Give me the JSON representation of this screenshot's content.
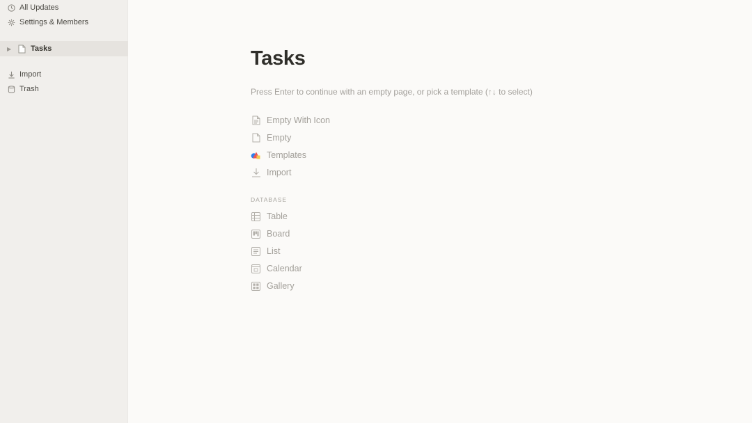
{
  "sidebar": {
    "all_updates": "All Updates",
    "settings": "Settings & Members",
    "page": {
      "label": "Tasks"
    },
    "import": "Import",
    "trash": "Trash"
  },
  "main": {
    "title": "Tasks",
    "hint": "Press Enter to continue with an empty page, or pick a template (↑↓ to select)",
    "options": [
      {
        "label": "Empty With Icon",
        "icon": "page-with-icon"
      },
      {
        "label": "Empty",
        "icon": "page-icon"
      },
      {
        "label": "Templates",
        "icon": "templates-icon"
      },
      {
        "label": "Import",
        "icon": "import-icon"
      }
    ],
    "database_label": "DATABASE",
    "database_options": [
      {
        "label": "Table",
        "icon": "table-icon"
      },
      {
        "label": "Board",
        "icon": "board-icon"
      },
      {
        "label": "List",
        "icon": "list-icon"
      },
      {
        "label": "Calendar",
        "icon": "calendar-icon"
      },
      {
        "label": "Gallery",
        "icon": "gallery-icon"
      }
    ]
  },
  "colors": {
    "sidebar_bg": "#f1efec",
    "main_bg": "#fbfaf8",
    "selected_bg": "#e6e3df",
    "templates_icon_blue": "#2f80ed",
    "templates_icon_red": "#eb5757",
    "templates_icon_yellow": "#f2c94c"
  }
}
